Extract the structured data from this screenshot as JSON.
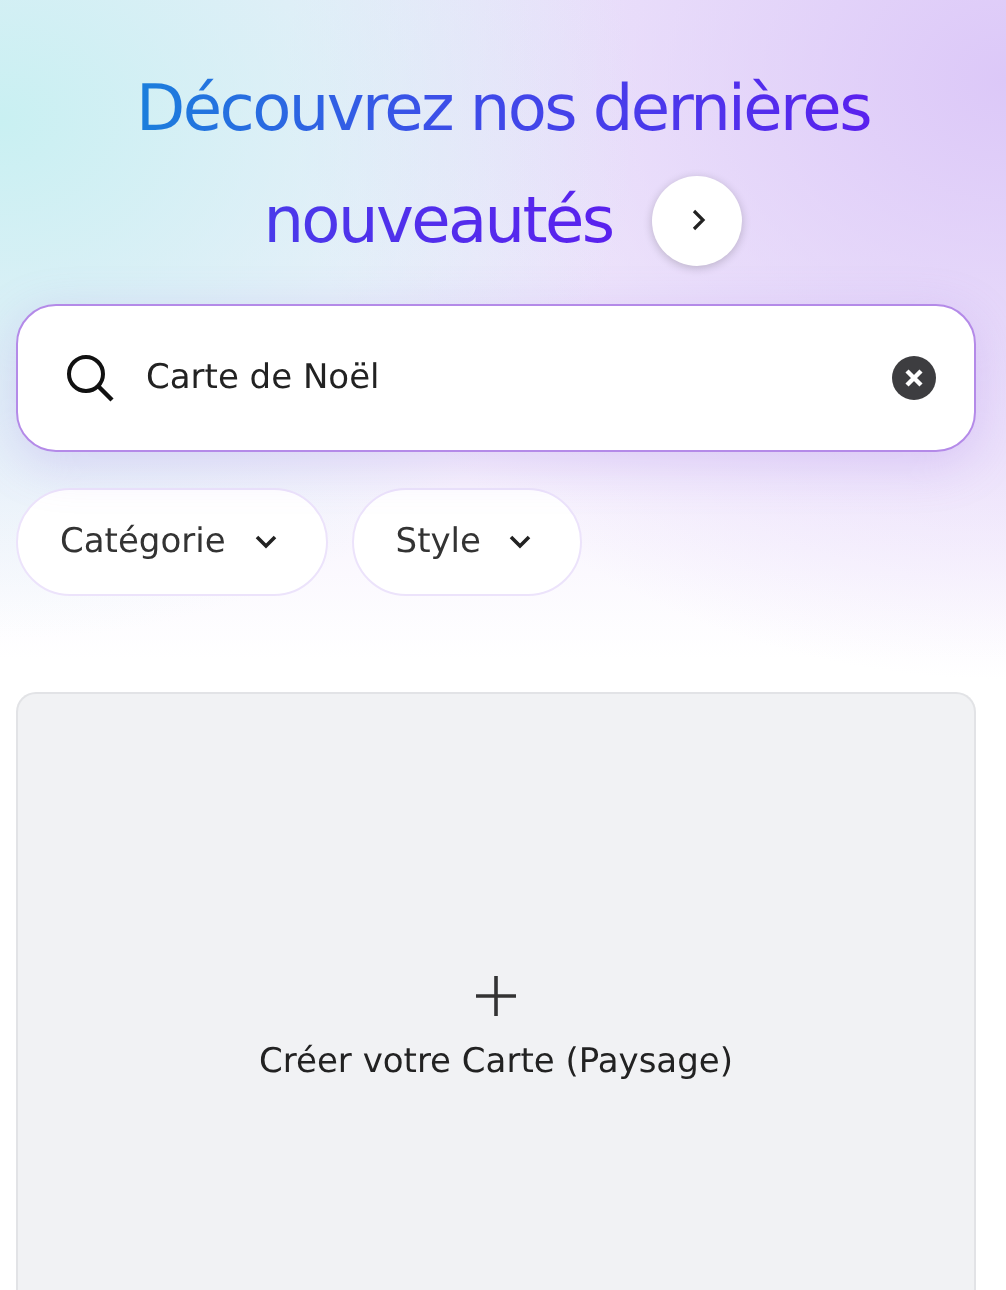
{
  "heading": {
    "lines": [
      "Découvrez nos dernières",
      "nouveautés"
    ]
  },
  "search": {
    "value": "Carte de Noël"
  },
  "filters": [
    {
      "label": "Catégorie"
    },
    {
      "label": "Style"
    }
  ],
  "create_card": {
    "label": "Créer votre Carte (Paysage)"
  }
}
